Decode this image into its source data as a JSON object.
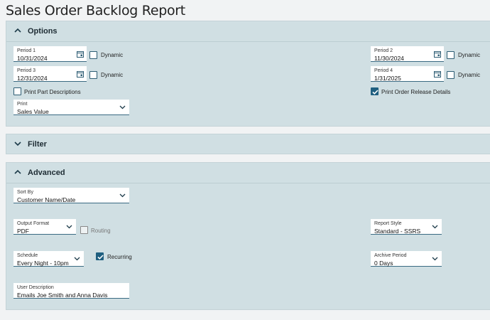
{
  "page_title": "Sales Order Backlog Report",
  "options": {
    "title": "Options",
    "period1": {
      "label": "Period 1",
      "value": "10/31/2024"
    },
    "period2": {
      "label": "Period 2",
      "value": "11/30/2024"
    },
    "period3": {
      "label": "Period 3",
      "value": "12/31/2024"
    },
    "period4": {
      "label": "Period 4",
      "value": "1/31/2025"
    },
    "dynamic_label": "Dynamic",
    "print_part_descriptions": {
      "label": "Print Part Descriptions",
      "checked": false
    },
    "print_order_release_details": {
      "label": "Print Order Release Details",
      "checked": true
    },
    "print": {
      "label": "Print",
      "value": "Sales Value"
    }
  },
  "filter": {
    "title": "Filter"
  },
  "advanced": {
    "title": "Advanced",
    "sort_by": {
      "label": "Sort By",
      "value": "Customer Name/Date"
    },
    "output_format": {
      "label": "Output Format",
      "value": "PDF"
    },
    "routing": {
      "label": "Routing",
      "checked": false,
      "disabled": true
    },
    "report_style": {
      "label": "Report Style",
      "value": "Standard - SSRS"
    },
    "schedule": {
      "label": "Schedule",
      "value": "Every Night - 10pm"
    },
    "recurring": {
      "label": "Recurring",
      "checked": true
    },
    "archive_period": {
      "label": "Archive Period",
      "value": "0 Days"
    },
    "user_description": {
      "label": "User Description",
      "value": "Emails Joe Smith and Anna Davis"
    }
  },
  "colors": {
    "panel_bg": "#d0dfe3",
    "accent": "#1f5f80",
    "page_bg": "#f1f3f4"
  }
}
